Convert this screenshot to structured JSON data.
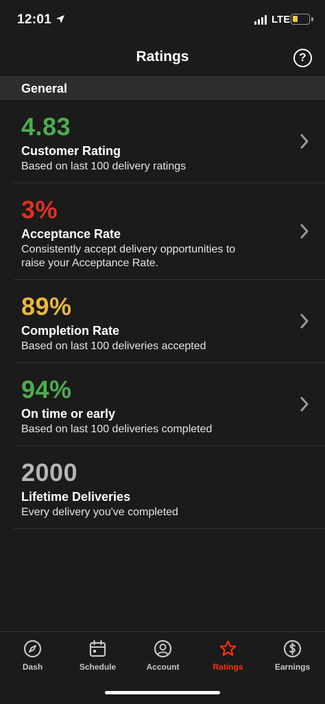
{
  "status_bar": {
    "time": "12:01",
    "network": "LTE",
    "battery_level": 0.3,
    "battery_color": "#f2cc3a"
  },
  "header": {
    "title": "Ratings",
    "help_icon": "question-circle-icon",
    "help_symbol": "?"
  },
  "section": {
    "title": "General"
  },
  "colors": {
    "green": "#4cae4f",
    "red": "#e0321e",
    "yellow": "#e9b83f",
    "gray": "#b5b5b5",
    "accent": "#ff3008"
  },
  "ratings": [
    {
      "value": "4.83",
      "label": "Customer Rating",
      "sub": "Based on last 100 delivery ratings",
      "color": "#4cae4f",
      "has_chevron": true
    },
    {
      "value": "3%",
      "label": "Acceptance Rate",
      "sub": "Consistently accept delivery opportunities to raise your Acceptance Rate.",
      "color": "#e0321e",
      "has_chevron": true
    },
    {
      "value": "89%",
      "label": "Completion Rate",
      "sub": "Based on last 100 deliveries accepted",
      "color": "#e9b83f",
      "has_chevron": true
    },
    {
      "value": "94%",
      "label": "On time or early",
      "sub": "Based on last 100 deliveries completed",
      "color": "#4cae4f",
      "has_chevron": true
    },
    {
      "value": "2000",
      "label": "Lifetime Deliveries",
      "sub": "Every delivery you've completed",
      "color": "#b5b5b5",
      "has_chevron": false
    }
  ],
  "tabs": [
    {
      "label": "Dash",
      "icon": "compass-icon",
      "active": false
    },
    {
      "label": "Schedule",
      "icon": "calendar-icon",
      "active": false
    },
    {
      "label": "Account",
      "icon": "user-icon",
      "active": false
    },
    {
      "label": "Ratings",
      "icon": "star-icon",
      "active": true
    },
    {
      "label": "Earnings",
      "icon": "dollar-icon",
      "active": false
    }
  ]
}
